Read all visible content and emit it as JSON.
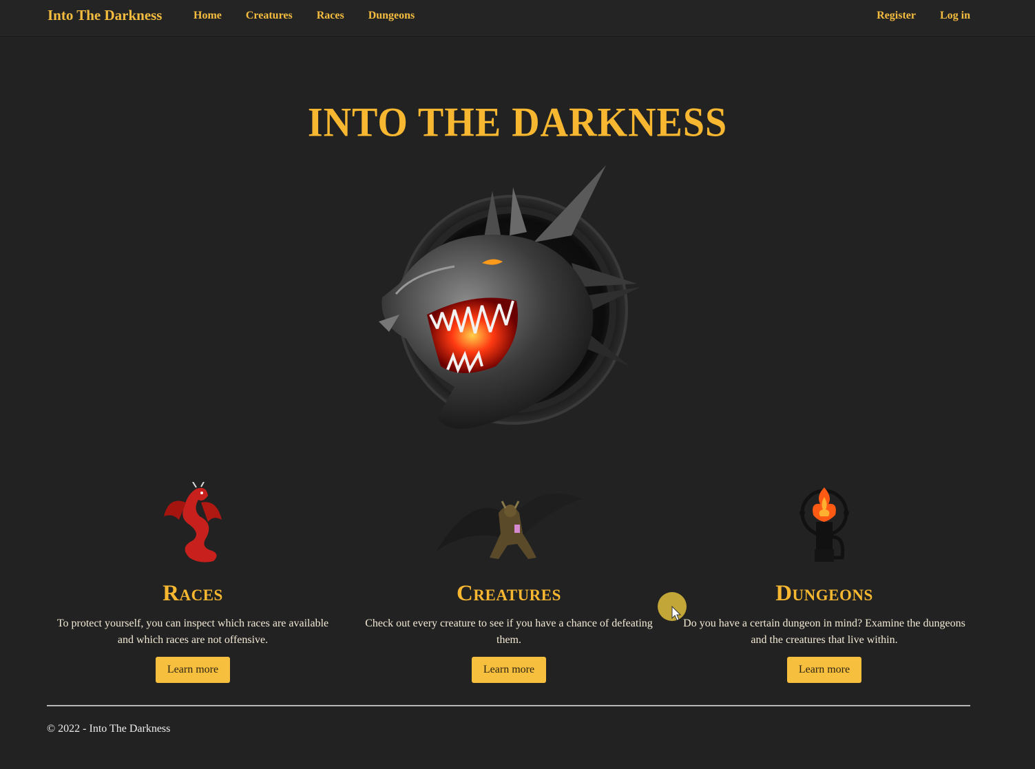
{
  "navbar": {
    "brand": "Into The Darkness",
    "links": [
      "Home",
      "Creatures",
      "Races",
      "Dungeons"
    ],
    "right_links": [
      "Register",
      "Log in"
    ]
  },
  "hero": {
    "title": "INTO THE DARKNESS",
    "image_icon": "dragon-head-emblem"
  },
  "sections": [
    {
      "title": "Races",
      "icon": "red-dragon",
      "description": "To protect yourself, you can inspect which races are available and which races are not offensive.",
      "button": "Learn more"
    },
    {
      "title": "Creatures",
      "icon": "winged-demon",
      "description": "Check out every creature to see if you have a chance of defeating them.",
      "button": "Learn more"
    },
    {
      "title": "Dungeons",
      "icon": "flaming-dungeon-tower",
      "description": "Do you have a certain dungeon in mind? Examine the dungeons and the creatures that live within.",
      "button": "Learn more"
    }
  ],
  "footer": {
    "text": "© 2022 - Into The Darkness"
  },
  "colors": {
    "background": "#222222",
    "accent": "#f7b731",
    "button": "#f7bf3e"
  }
}
